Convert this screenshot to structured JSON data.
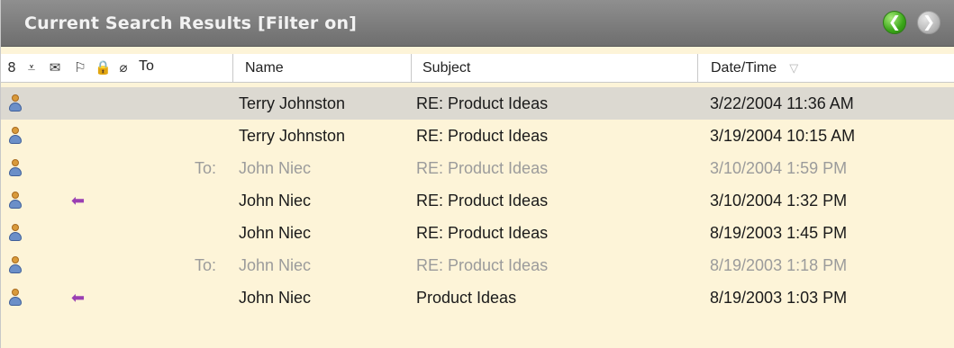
{
  "titlebar": {
    "title": "Current Search Results  [Filter on]",
    "back_icon": "arrow-left-icon",
    "forward_icon": "arrow-right-icon",
    "back_glyph": "❮",
    "forward_glyph": "❯"
  },
  "header": {
    "icons": [
      {
        "name": "person-icon",
        "glyph": "8"
      },
      {
        "name": "flag-filter-icon",
        "glyph": "⩡"
      },
      {
        "name": "envelope-icon",
        "glyph": "✉"
      },
      {
        "name": "follow-up-flag-icon",
        "glyph": "⚐"
      },
      {
        "name": "lock-icon",
        "glyph": "🔒"
      },
      {
        "name": "attachment-icon",
        "glyph": "⌀"
      }
    ],
    "to": "To",
    "name": "Name",
    "subject": "Subject",
    "datetime": "Date/Time",
    "sort_icon": "▽"
  },
  "rows": [
    {
      "to": "",
      "name": "Terry Johnston",
      "subject": "RE: Product Ideas",
      "datetime": "3/22/2004 11:36 AM",
      "replied": false,
      "dim": false,
      "selected": true
    },
    {
      "to": "",
      "name": "Terry Johnston",
      "subject": "RE: Product Ideas",
      "datetime": "3/19/2004 10:15 AM",
      "replied": false,
      "dim": false,
      "selected": false
    },
    {
      "to": "To:",
      "name": "John Niec",
      "subject": "RE: Product Ideas",
      "datetime": "3/10/2004 1:59 PM",
      "replied": false,
      "dim": true,
      "selected": false
    },
    {
      "to": "",
      "name": "John Niec",
      "subject": "RE: Product Ideas",
      "datetime": "3/10/2004 1:32 PM",
      "replied": true,
      "dim": false,
      "selected": false
    },
    {
      "to": "",
      "name": "John Niec",
      "subject": "RE: Product Ideas",
      "datetime": "8/19/2003 1:45 PM",
      "replied": false,
      "dim": false,
      "selected": false
    },
    {
      "to": "To:",
      "name": "John Niec",
      "subject": "RE: Product Ideas",
      "datetime": "8/19/2003 1:18 PM",
      "replied": false,
      "dim": true,
      "selected": false
    },
    {
      "to": "",
      "name": "John Niec",
      "subject": "Product Ideas",
      "datetime": "8/19/2003 1:03 PM",
      "replied": true,
      "dim": false,
      "selected": false
    }
  ],
  "reply_glyph": "⬅",
  "colors": {
    "titlebar": "#7d7d7d",
    "panel_bg": "#fdf4d8",
    "selected_row": "#dcd9d1",
    "dim_text": "#9b9b9b",
    "reply_arrow": "#9a3fb3",
    "back_button": "#3aa618"
  }
}
